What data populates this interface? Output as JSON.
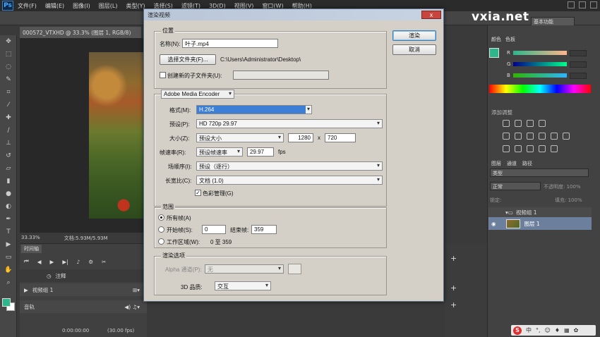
{
  "app": {
    "logo": "Ps",
    "menus": [
      "文件(F)",
      "编辑(E)",
      "图像(I)",
      "图层(L)",
      "类型(Y)",
      "选择(S)",
      "滤镜(T)",
      "3D(D)",
      "视图(V)",
      "窗口(W)",
      "帮助(H)"
    ],
    "preset": "基本功能",
    "watermark": "vxia.net"
  },
  "document": {
    "tab_title": "000572_VTXHD @ 33.3% (图层 1, RGB/8)",
    "zoom": "33.33%",
    "doc_size": "文档:5.93M/5.93M"
  },
  "timeline": {
    "tab": "时间轴",
    "note_track": "注释",
    "group_track": "视频组 1",
    "audio_track": "音轨",
    "timecode": "0:00:00:00",
    "fps": "(30.00 fps)"
  },
  "panels": {
    "color_tab": "颜色",
    "swatches_tab": "色板",
    "channels": [
      "R",
      "G",
      "B"
    ],
    "adjust_title": "添加调整",
    "layers_tabs": [
      "图层",
      "通道",
      "路径"
    ],
    "search_placeholder": "类型",
    "blend_mode": "正常",
    "opacity_label": "不透明度:",
    "opacity_value": "100%",
    "lock_label": "锁定:",
    "fill_label": "填充:",
    "fill_value": "100%",
    "layer_group": "视频组 1",
    "layer_name": "图层 1"
  },
  "dialog": {
    "title": "渲染视频",
    "close_label": "x",
    "location": {
      "title": "位置",
      "name_label": "名称(N):",
      "name_value": "叶子.mp4",
      "select_folder_button": "选择文件夹(F)...",
      "folder_path": "C:\\Users\\Administrator\\Desktop\\",
      "subfolder_label": "创建新的子文件夹(U):"
    },
    "encoder": {
      "selected": "Adobe Media Encoder",
      "format_label": "格式(M):",
      "format_value": "H.264",
      "preset_label": "预设(P):",
      "preset_value": "HD 720p 29.97",
      "size_label": "大小(Z):",
      "size_preset": "预设大小",
      "width": "1280",
      "x_label": "x",
      "height": "720",
      "framerate_label": "帧速率(R):",
      "framerate_preset": "预设帧速率",
      "framerate_value": "29.97",
      "fps_label": "fps",
      "field_order_label": "场顺序(I):",
      "field_order_value": "预设（逐行）",
      "aspect_label": "长宽比(C):",
      "aspect_value": "文档 (1.0)",
      "color_manage_label": "色彩管理(G)",
      "color_manage_checked": true
    },
    "range": {
      "title": "范围",
      "all_frames": "所有帧(A)",
      "start_label": "开始帧(S):",
      "start_value": "0",
      "end_label": "结束帧:",
      "end_value": "359",
      "work_area_label": "工作区域(W):",
      "work_area_value": "0 至 359"
    },
    "render": {
      "title": "渲染选项",
      "alpha_label": "Alpha 通道(P):",
      "alpha_value": "无",
      "quality_label": "3D 品质:",
      "quality_value": "交互"
    },
    "render_button": "渲染",
    "cancel_button": "取消"
  },
  "ime": {
    "logo": "S",
    "lang": "中"
  }
}
